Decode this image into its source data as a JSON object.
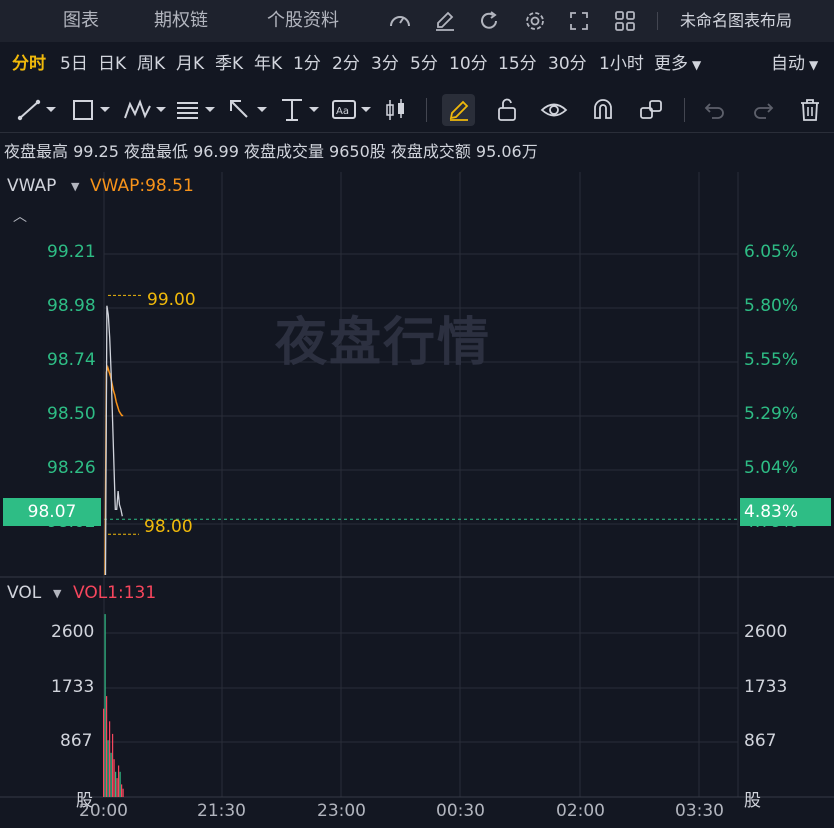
{
  "topbar": {
    "tabs": [
      {
        "label": "图表",
        "active": true
      },
      {
        "label": "期权链",
        "active": false
      },
      {
        "label": "个股资料",
        "active": false
      }
    ],
    "icons": [
      "speedometer-icon",
      "edit-icon",
      "refresh-icon",
      "gear-icon",
      "fullscreen-icon",
      "grid-layout-icon"
    ],
    "layout_name": "未命名图表布局"
  },
  "intervals": {
    "items": [
      "分时",
      "5日",
      "日K",
      "周K",
      "月K",
      "季K",
      "年K",
      "1分",
      "2分",
      "3分",
      "5分",
      "10分",
      "15分",
      "30分",
      "1小时",
      "更多"
    ],
    "active": "分时",
    "auto_label": "自动"
  },
  "tools": [
    "line-tool-icon",
    "rectangle-tool-icon",
    "pattern-tool-icon",
    "fib-tool-icon",
    "arrow-tool-icon",
    "measure-tool-icon",
    "text-tool-icon",
    "candle-tool-icon",
    "pencil-icon",
    "unlock-icon",
    "eye-icon",
    "magnet-icon",
    "link-icon",
    "undo-icon",
    "redo-icon",
    "trash-icon"
  ],
  "info": "夜盘最高 99.25 夜盘最低 96.99 夜盘成交量 9650股 夜盘成交额 95.06万",
  "price_panel": {
    "indicator_name": "VWAP",
    "indicator_value": "VWAP:98.51",
    "left_ticks": [
      "99.21",
      "98.98",
      "98.74",
      "98.50",
      "98.26",
      "98.02"
    ],
    "right_ticks": [
      "6.05%",
      "5.80%",
      "5.55%",
      "5.29%",
      "5.04%",
      "4.79%"
    ],
    "current_price": "98.07",
    "current_pct": "4.83%",
    "high_label": "99.00",
    "low_label": "98.00",
    "watermark": "夜盘行情"
  },
  "volume_panel": {
    "indicator_name": "VOL",
    "indicator_value": "VOL1:131",
    "left_ticks": [
      "2600",
      "1733",
      "867",
      "股"
    ],
    "right_ticks": [
      "2600",
      "1733",
      "867",
      "股"
    ]
  },
  "time_axis": [
    "20:00",
    "21:30",
    "23:00",
    "00:30",
    "02:00",
    "03:30"
  ],
  "colors": {
    "accent": "#f0b90b",
    "up": "#2ebd85",
    "down": "#f6465d",
    "vwap": "#f7931a",
    "price_line": "#d1d4dc"
  },
  "chart_data": {
    "type": "line",
    "series": [
      {
        "name": "VWAP",
        "x": [
          "20:00",
          "20:01",
          "20:02",
          "20:03",
          "20:04",
          "20:05",
          "20:06",
          "20:07",
          "20:08",
          "20:09",
          "20:10",
          "20:11",
          "20:12",
          "20:13"
        ],
        "values": [
          96.99,
          98.7,
          98.72,
          98.7,
          98.68,
          98.65,
          98.62,
          98.6,
          98.57,
          98.55,
          98.53,
          98.52,
          98.51,
          98.51
        ]
      }
    ],
    "price": {
      "x": [
        "20:00",
        "20:01",
        "20:02",
        "20:03",
        "20:04",
        "20:05",
        "20:06",
        "20:07",
        "20:08",
        "20:09",
        "20:10",
        "20:11",
        "20:12"
      ],
      "values": [
        97.0,
        98.99,
        98.95,
        98.85,
        98.7,
        98.5,
        98.3,
        98.1,
        98.1,
        98.18,
        98.12,
        98.1,
        98.07
      ]
    },
    "volume": {
      "values": [
        1400,
        2900,
        1600,
        900,
        1200,
        700,
        1000,
        600,
        400,
        300,
        500,
        400,
        200,
        131
      ],
      "direction": [
        "down",
        "up",
        "down",
        "up",
        "down",
        "up",
        "down",
        "down",
        "up",
        "down",
        "down",
        "up",
        "down",
        "down"
      ]
    },
    "ylim": [
      97.9,
      99.3
    ],
    "vol_ylim": [
      0,
      3000
    ]
  }
}
